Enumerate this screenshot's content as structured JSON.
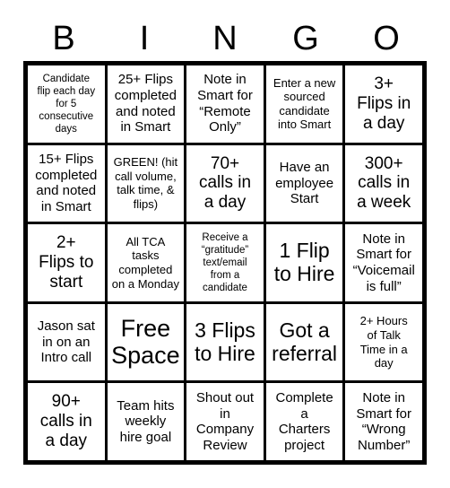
{
  "header": {
    "letters": [
      "B",
      "I",
      "N",
      "G",
      "O"
    ]
  },
  "grid": {
    "rows": 5,
    "columns": 5,
    "border_color": "#000000",
    "cell_background": "#ffffff",
    "text_color": "#000000",
    "cells": [
      {
        "text": "Candidate\nflip each day\nfor 5\nconsecutive\ndays",
        "size": "xs"
      },
      {
        "text": "25+ Flips\ncompleted\nand noted\nin Smart",
        "size": "m"
      },
      {
        "text": "Note in\nSmart for\n“Remote\nOnly”",
        "size": "m"
      },
      {
        "text": "Enter a new\nsourced\ncandidate\ninto Smart",
        "size": "s"
      },
      {
        "text": "3+\nFlips in\na day",
        "size": "l"
      },
      {
        "text": "15+ Flips\ncompleted\nand noted\nin Smart",
        "size": "m"
      },
      {
        "text": "GREEN! (hit\ncall volume,\ntalk time, &\nflips)",
        "size": "s"
      },
      {
        "text": "70+\ncalls in\na day",
        "size": "l"
      },
      {
        "text": "Have an\nemployee\nStart",
        "size": "m"
      },
      {
        "text": "300+\ncalls in\na week",
        "size": "l"
      },
      {
        "text": "2+\nFlips to\nstart",
        "size": "l"
      },
      {
        "text": "All TCA\ntasks\ncompleted\non a Monday",
        "size": "s"
      },
      {
        "text": "Receive a\n“gratitude”\ntext/email\nfrom a\ncandidate",
        "size": "xs"
      },
      {
        "text": "1 Flip\nto Hire",
        "size": "xl"
      },
      {
        "text": "Note in\nSmart for\n“Voicemail\nis full”",
        "size": "m"
      },
      {
        "text": "Jason sat\nin on an\nIntro call",
        "size": "m"
      },
      {
        "text": "Free\nSpace",
        "size": "xxl"
      },
      {
        "text": "3 Flips\nto Hire",
        "size": "xl"
      },
      {
        "text": "Got a\nreferral",
        "size": "xl"
      },
      {
        "text": "2+ Hours\nof Talk\nTime in a\nday",
        "size": "s"
      },
      {
        "text": "90+\ncalls in\na day",
        "size": "l"
      },
      {
        "text": "Team hits\nweekly\nhire goal",
        "size": "m"
      },
      {
        "text": "Shout out\nin\nCompany\nReview",
        "size": "m"
      },
      {
        "text": "Complete\na\nCharters\nproject",
        "size": "m"
      },
      {
        "text": "Note in\nSmart for\n“Wrong\nNumber”",
        "size": "m"
      }
    ]
  }
}
